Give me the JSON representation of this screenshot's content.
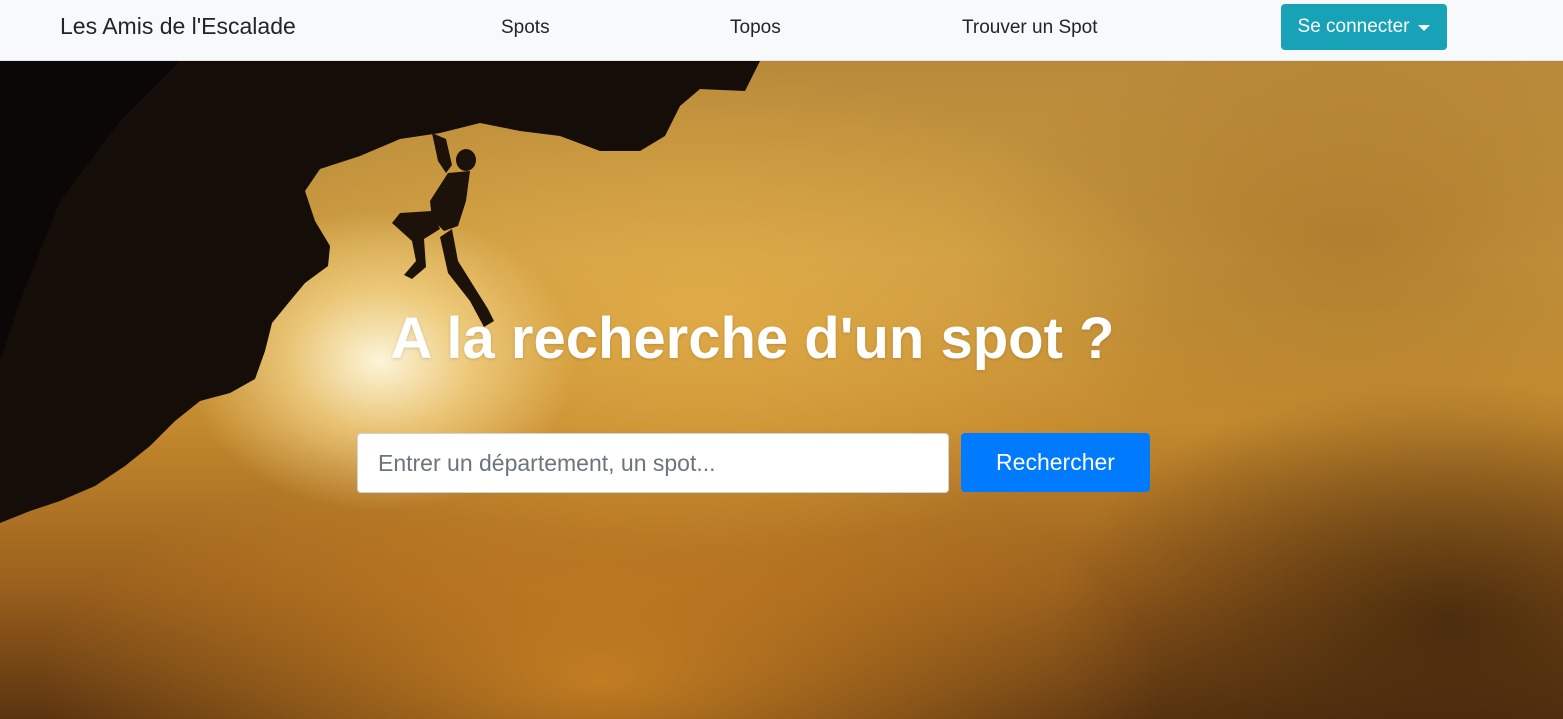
{
  "navbar": {
    "brand": "Les Amis de l'Escalade",
    "links": [
      "Spots",
      "Topos",
      "Trouver un Spot"
    ],
    "login_label": "Se connecter",
    "login_color": "#17a2b8"
  },
  "hero": {
    "background_description_icon": "climber-silhouette-sunset",
    "title": "A la recherche d'un spot ?",
    "search": {
      "placeholder": "Entrer un département, un spot...",
      "value": ""
    },
    "search_button_label": "Rechercher",
    "search_button_color": "#007bff"
  }
}
